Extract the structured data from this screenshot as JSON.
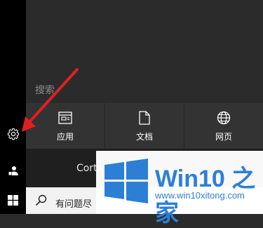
{
  "search_panel": {
    "heading": "搜索",
    "categories": [
      {
        "label": "应用",
        "icon": "app-window-icon"
      },
      {
        "label": "文档",
        "icon": "document-icon"
      },
      {
        "label": "网页",
        "icon": "globe-icon"
      }
    ],
    "cortana_label": "Corta",
    "search_box_text": "有问题尽"
  },
  "sidebar": {
    "buttons": [
      {
        "name": "settings",
        "icon": "gear-icon"
      },
      {
        "name": "account",
        "icon": "person-icon"
      },
      {
        "name": "start",
        "icon": "windows-logo-icon"
      }
    ]
  },
  "watermark": {
    "title": "Win10 之家",
    "url": "www.win10xitong.com"
  },
  "colors": {
    "panel_bg": "#2b2b2b",
    "tile_bg": "#333333",
    "sidebar_bg": "#000000",
    "arrow": "#e0201f",
    "watermark_blue": "#2d7fd6"
  }
}
